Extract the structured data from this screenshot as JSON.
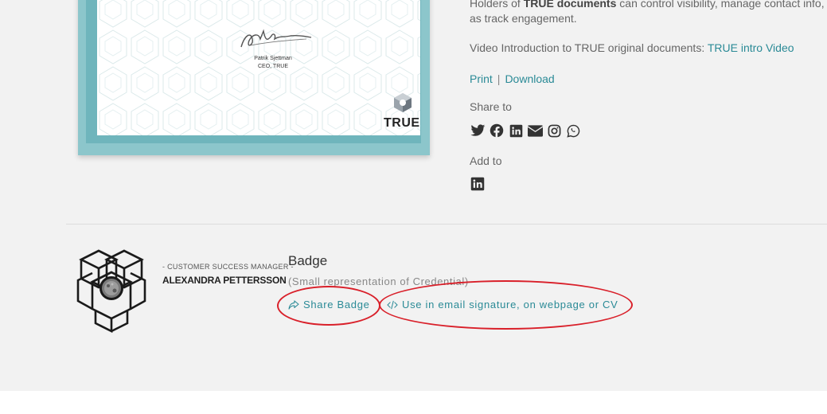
{
  "certificate": {
    "signer_name": "Patrik Sjettman",
    "signer_title": "CEO, TRUE",
    "logo_text": "TRUE",
    "frame_color": "#8cc6cb"
  },
  "info": {
    "line1_prefix": "Holders of ",
    "line1_bold": "TRUE documents",
    "line1_suffix": " can control visibility, manage contact info, share",
    "line2": "as track engagement.",
    "video_label": "Video Introduction to TRUE original documents: ",
    "video_link": "TRUE intro Video"
  },
  "actions": {
    "print": "Print",
    "separator": "|",
    "download": "Download"
  },
  "share": {
    "label": "Share to",
    "icons": [
      "twitter-icon",
      "facebook-icon",
      "linkedin-icon",
      "email-icon",
      "instagram-icon",
      "whatsapp-icon"
    ]
  },
  "add_to": {
    "label": "Add to",
    "icon": "linkedin-icon"
  },
  "badge": {
    "role": "- CUSTOMER SUCCESS MANAGER -",
    "name": "ALEXANDRA PETTERSSON",
    "title": "Badge",
    "subtitle": "(Small representation of Credential)",
    "share_label": "Share Badge",
    "embed_label": "Use in email signature, on webpage or CV"
  },
  "colors": {
    "link": "#2a8a96",
    "annotation": "#d9202a",
    "background": "#f2f2f2"
  }
}
